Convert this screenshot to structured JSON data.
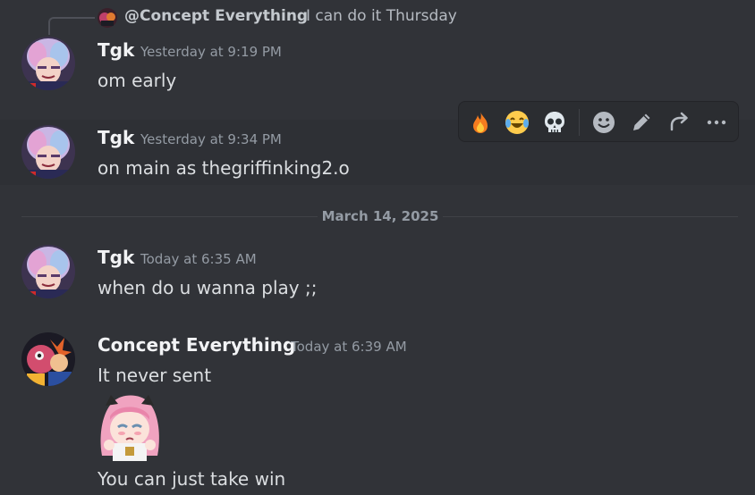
{
  "reply": {
    "mention": "@Concept Everything",
    "text": "I can do it Thursday"
  },
  "messages": [
    {
      "author": "Tgk",
      "timestamp": "Yesterday at 9:19 PM",
      "text": "om early"
    },
    {
      "author": "Tgk",
      "timestamp": "Yesterday at 9:34 PM",
      "text": "on main as thegriffinking2.o"
    },
    {
      "author": "Tgk",
      "timestamp": "Today at 6:35 AM",
      "text": "when do u wanna play ;;"
    },
    {
      "author": "Concept Everything",
      "timestamp": "Today at 6:39 AM",
      "text": "It never sent",
      "text2": "You can just take win"
    }
  ],
  "date_divider": "March 14, 2025",
  "toolbar": {
    "reactions": [
      "fire-emoji",
      "joy-emoji",
      "skull-emoji"
    ],
    "actions": [
      "add-reaction-icon",
      "edit-icon",
      "forward-icon",
      "more-icon"
    ]
  },
  "colors": {
    "background": "#313338",
    "hover": "#2e3035",
    "text": "#dbdee1",
    "username": "#f2f3f5",
    "timestamp": "#949ba4"
  }
}
